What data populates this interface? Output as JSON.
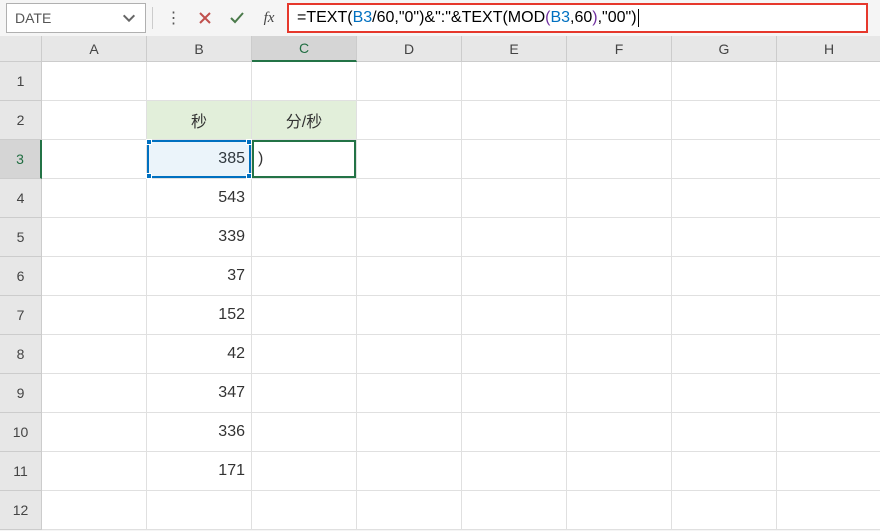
{
  "name_box": "DATE",
  "formula": {
    "full": "=TEXT(B3/60,\"0\")&\":\"&TEXT(MOD(B3,60),\"00\")",
    "parts": [
      {
        "t": "=TEXT",
        "c": "f-black"
      },
      {
        "t": "(",
        "c": "f-paren1"
      },
      {
        "t": "B3",
        "c": "f-blue"
      },
      {
        "t": "/60,\"0\"",
        "c": "f-black"
      },
      {
        "t": ")",
        "c": "f-paren1"
      },
      {
        "t": "&\":\"&TEXT",
        "c": "f-black"
      },
      {
        "t": "(",
        "c": "f-paren1"
      },
      {
        "t": "MOD",
        "c": "f-black"
      },
      {
        "t": "(",
        "c": "f-paren2"
      },
      {
        "t": "B3",
        "c": "f-blue"
      },
      {
        "t": ",60",
        "c": "f-black"
      },
      {
        "t": ")",
        "c": "f-paren2"
      },
      {
        "t": ",\"00\"",
        "c": "f-black"
      },
      {
        "t": ")",
        "c": "f-paren1"
      }
    ]
  },
  "columns": [
    "A",
    "B",
    "C",
    "D",
    "E",
    "F",
    "G",
    "H"
  ],
  "rows": [
    "1",
    "2",
    "3",
    "4",
    "5",
    "6",
    "7",
    "8",
    "9",
    "10",
    "11",
    "12"
  ],
  "selected_col": "C",
  "selected_row": "3",
  "headers": {
    "B2": "秒",
    "C2": "分/秒"
  },
  "data": {
    "B3": "385",
    "B4": "543",
    "B5": "339",
    "B6": "37",
    "B7": "152",
    "B8": "42",
    "B9": "347",
    "B10": "336",
    "B11": "171"
  },
  "active_cell_display": ")"
}
